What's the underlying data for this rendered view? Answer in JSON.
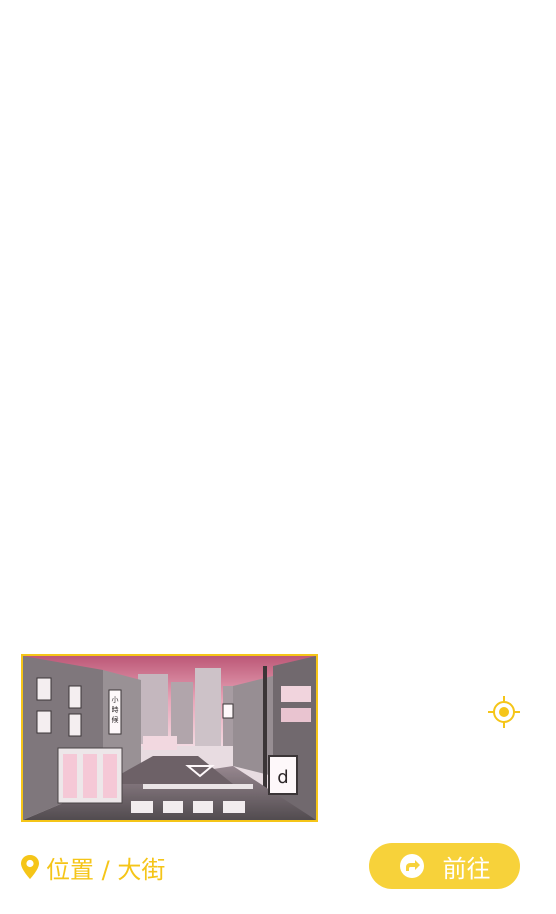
{
  "location": {
    "icon": "map-pin-icon",
    "label": "位置 / 大街"
  },
  "go_button": {
    "icon": "share-arrow-icon",
    "label": "前往"
  },
  "locate_button": {
    "icon": "crosshair-locate-icon"
  },
  "thumbnail": {
    "sign_text": "小時候",
    "shop_letter": "d"
  },
  "colors": {
    "accent": "#f5c518",
    "button": "#f7d23a",
    "sky": "#c9687e"
  }
}
